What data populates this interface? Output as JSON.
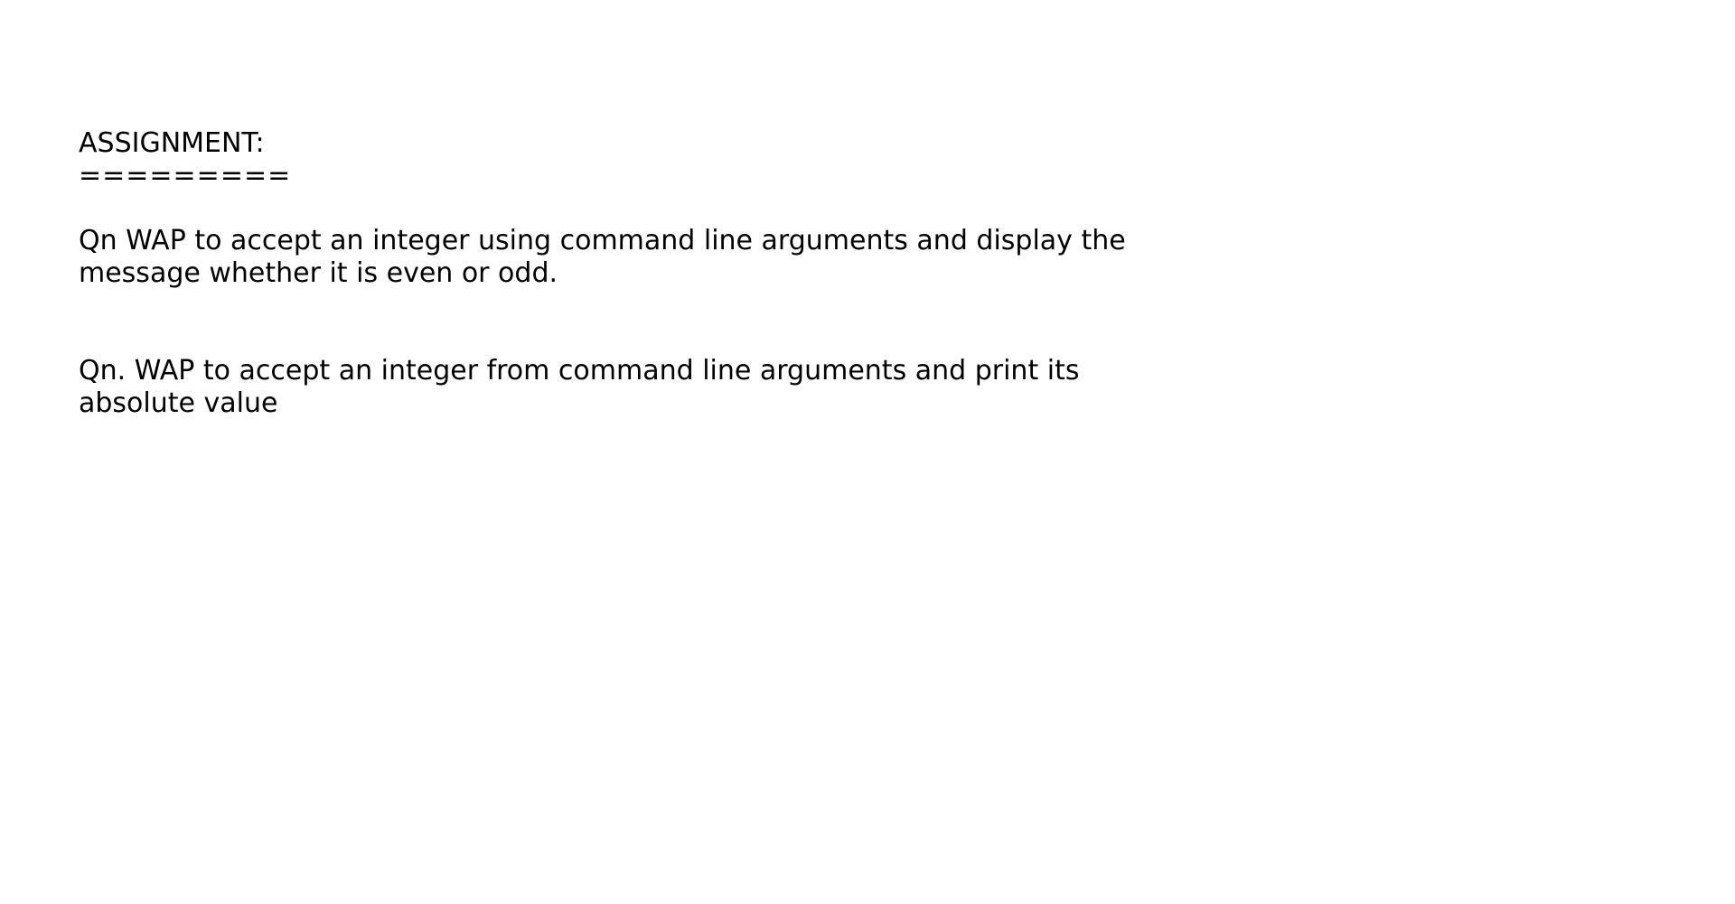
{
  "document": {
    "heading": "ASSIGNMENT:",
    "heading_underline": "=========",
    "questions": [
      {
        "line1": "Qn WAP to accept an integer using command line arguments and display the",
        "line2": "message whether it is even or odd."
      },
      {
        "line1": "Qn. WAP to accept an integer from command line arguments and print its",
        "line2": "absolute value"
      }
    ]
  }
}
